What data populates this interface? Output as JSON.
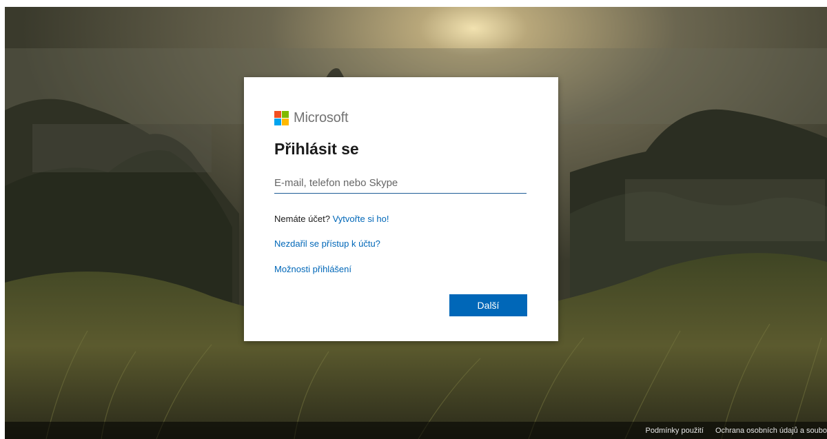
{
  "brand": {
    "name": "Microsoft",
    "logo_colors": [
      "#f25022",
      "#7fba00",
      "#00a4ef",
      "#ffb900"
    ]
  },
  "signin": {
    "title": "Přihlásit se",
    "email_placeholder": "E-mail, telefon nebo Skype",
    "email_value": "",
    "no_account_text": "Nemáte účet?",
    "create_account_link": "Vytvořte si ho!",
    "cant_access_link": "Nezdařil se přístup k účtu?",
    "signin_options_link": "Možnosti přihlášení",
    "next_button": "Další"
  },
  "footer": {
    "terms": "Podmínky použití",
    "privacy": "Ochrana osobních údajů a soubo"
  },
  "colors": {
    "accent": "#0067b8",
    "input_underline": "#1d5c96"
  }
}
